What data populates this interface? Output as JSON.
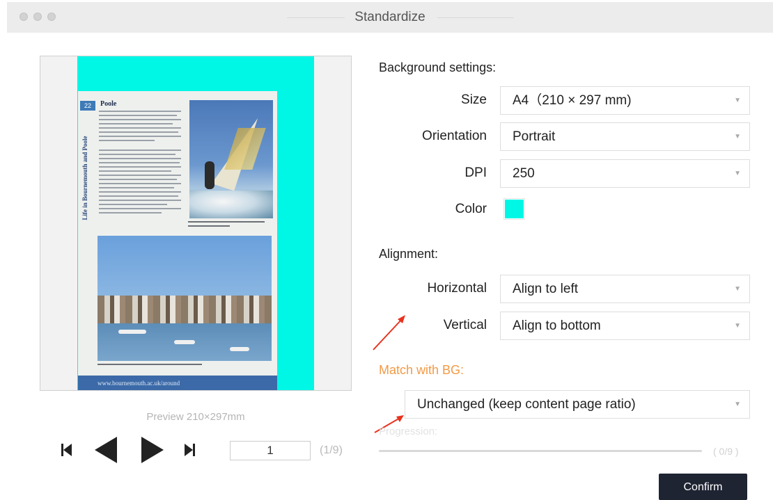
{
  "window": {
    "title": "Standardize"
  },
  "preview": {
    "caption": "Preview  210×297mm",
    "thumbnail": {
      "page_number": "22",
      "vertical_text": "Life in Bournemouth and Poole",
      "article_title": "Poole",
      "footer_text": "www.bournemouth.ac.uk/around"
    }
  },
  "navigation": {
    "page_value": "1",
    "page_count": "(1/9)",
    "icons": {
      "first": "skip-to-first-icon",
      "prev": "previous-icon",
      "next": "next-icon",
      "last": "skip-to-last-icon"
    }
  },
  "background_settings": {
    "heading": "Background settings:",
    "size_label": "Size",
    "size_value": "A4（210 × 297 mm)",
    "orientation_label": "Orientation",
    "orientation_value": "Portrait",
    "dpi_label": "DPI",
    "dpi_value": "250",
    "color_label": "Color",
    "color_value": "#00f7e6"
  },
  "alignment": {
    "heading": "Alignment:",
    "horizontal_label": "Horizontal",
    "horizontal_value": "Align to left",
    "vertical_label": "Vertical",
    "vertical_value": "Align to bottom"
  },
  "match_bg": {
    "heading": "Match with BG:",
    "value": "Unchanged (keep content page ratio)"
  },
  "progress": {
    "label": "Progression:",
    "count": "( 0/9 )",
    "fraction": 0
  },
  "confirm_label": "Confirm",
  "colors": {
    "accent_orange": "#f39a45",
    "annotation_red": "#e8321e",
    "confirm_bg": "#1f2433",
    "background_cyan": "#00f7e6"
  }
}
